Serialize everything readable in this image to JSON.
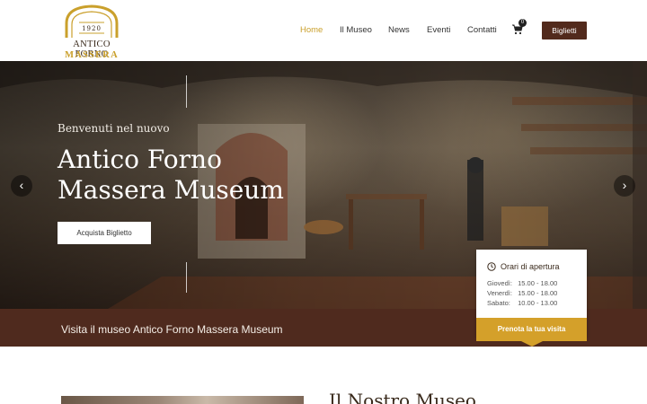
{
  "logo": {
    "year": "1920",
    "line1": "ANTICO FORNO",
    "line2": "MASSERA"
  },
  "nav": {
    "items": [
      {
        "label": "Home",
        "active": true
      },
      {
        "label": "Il Museo"
      },
      {
        "label": "News"
      },
      {
        "label": "Eventi"
      },
      {
        "label": "Contatti"
      }
    ],
    "cart_count": "0",
    "cart_icon": "shopping-cart-icon",
    "tickets_label": "Biglietti"
  },
  "hero": {
    "welcome": "Benvenuti nel nuovo",
    "title": "Antico Forno Massera Museum",
    "cta_label": "Acquista Biglietto",
    "prev_icon": "chevron-left-icon",
    "next_icon": "chevron-right-icon"
  },
  "hours": {
    "icon": "clock-icon",
    "title": "Orari di apertura",
    "rows": [
      {
        "day": "Giovedì:",
        "time": "15.00 - 18.00"
      },
      {
        "day": "Venerdì:",
        "time": "15.00 - 18.00"
      },
      {
        "day": "Sabato:",
        "time": "10.00 - 13.00"
      }
    ],
    "cta_label": "Prenota la tua visita"
  },
  "band": {
    "text": "Visita il museo Antico Forno Massera Museum"
  },
  "about": {
    "title": "Il Nostro Museo"
  },
  "colors": {
    "gold": "#caa02c",
    "brown": "#4f2a1e",
    "button_gold": "#d4a02a"
  }
}
